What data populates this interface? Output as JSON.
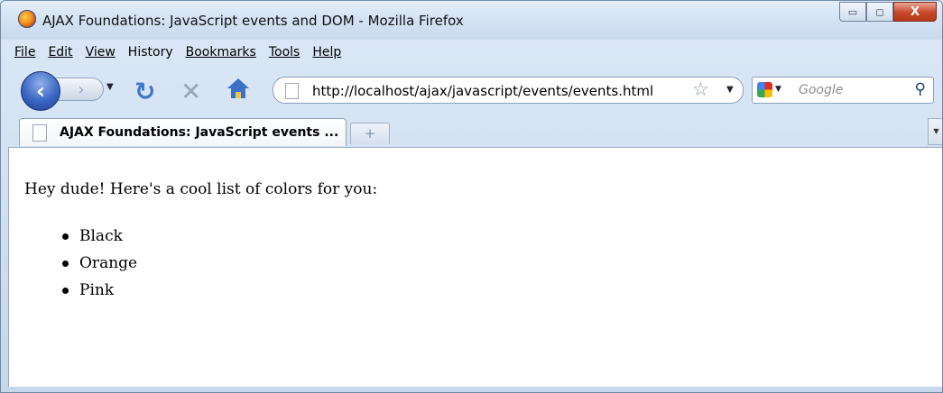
{
  "window": {
    "title": "AJAX Foundations: JavaScript events and DOM - Mozilla Firefox",
    "controls": {
      "minimize": "▭",
      "maximize": "◻",
      "close": "X"
    }
  },
  "menu": [
    {
      "label": "File"
    },
    {
      "label": "Edit"
    },
    {
      "label": "View"
    },
    {
      "label": "History"
    },
    {
      "label": "Bookmarks"
    },
    {
      "label": "Tools"
    },
    {
      "label": "Help"
    }
  ],
  "nav": {
    "back_icon": "‹",
    "forward_icon": "›",
    "url": "http://localhost/ajax/javascript/events/events.html",
    "search_placeholder": "Google"
  },
  "tabs": [
    {
      "label": "AJAX Foundations: JavaScript events ..."
    }
  ],
  "new_tab_label": "+",
  "page": {
    "intro": "Hey dude! Here's a cool list of colors for you:",
    "colors": [
      "Black",
      "Orange",
      "Pink"
    ]
  },
  "theme": {
    "accent": "#3b72c8",
    "window_frame": "#c7d8ec",
    "close_button": "#c7472b"
  }
}
